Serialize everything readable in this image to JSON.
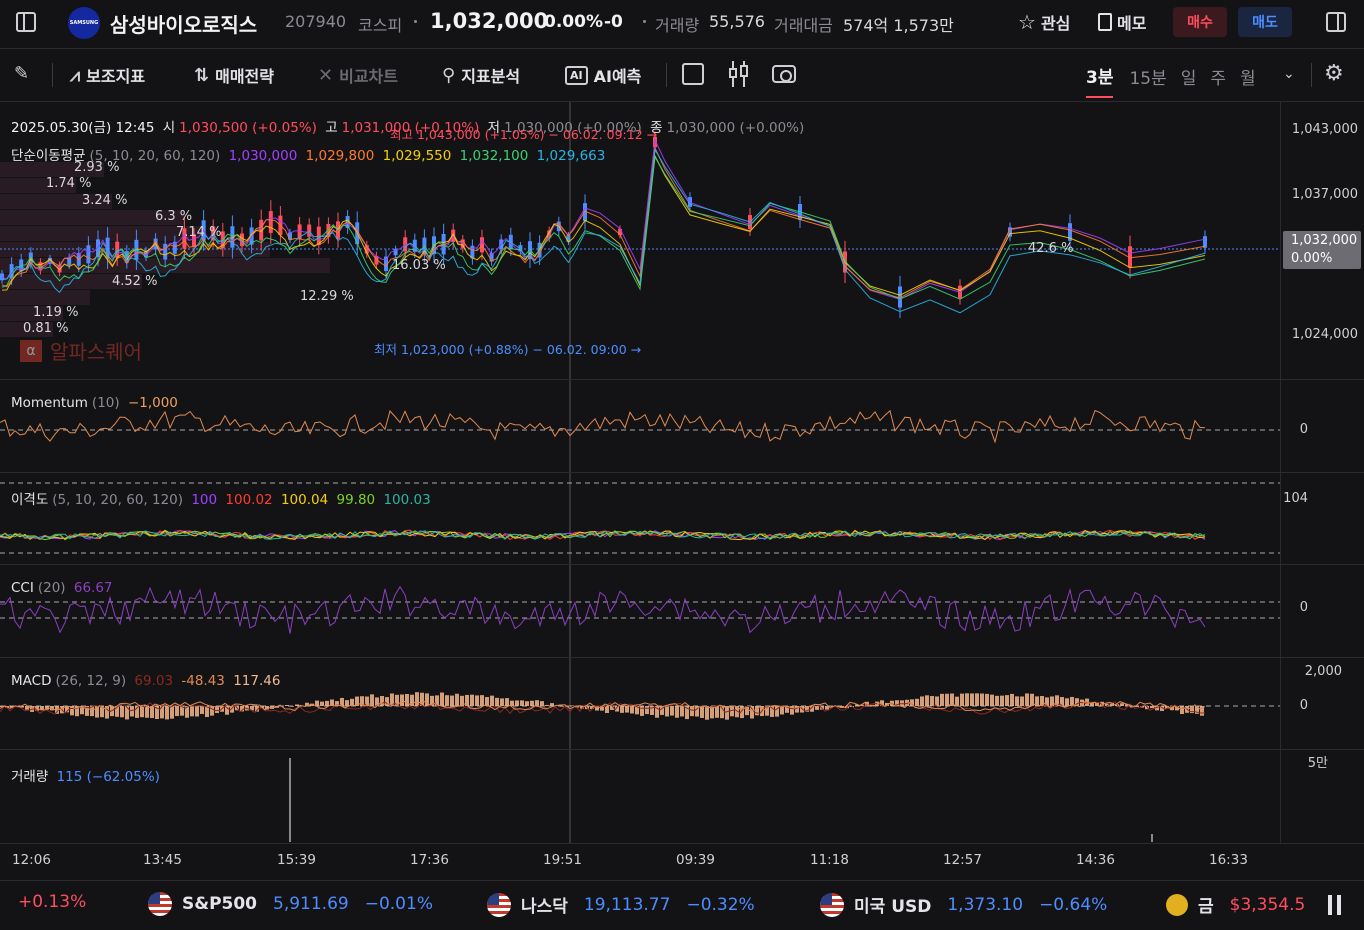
{
  "header": {
    "logo_text": "SAMSUNG",
    "name": "삼성바이오로직스",
    "code": "207940",
    "market": "코스피",
    "price": "1,032,000",
    "change_pct": "0.00%",
    "change": "-0",
    "volume_label": "거래량",
    "volume": "55,576",
    "amount_label": "거래대금",
    "amount": "574억 1,573만",
    "watch": "관심",
    "memo": "메모",
    "buy": "매수",
    "sell": "매도"
  },
  "toolbar": {
    "indicators": "보조지표",
    "strategy": "매매전략",
    "compare": "비교차트",
    "analysis": "지표분석",
    "ai": "AI예측",
    "ai_badge": "AI",
    "periods": [
      "3분",
      "15분",
      "일",
      "주",
      "월"
    ],
    "active_period": "3분"
  },
  "main_chart": {
    "date": "2025.05.30(금) 12:45",
    "open_label": "시",
    "open": "1,030,500 (+0.05%)",
    "high_label": "고",
    "high": "1,031,000 (+0.10%)",
    "low_label": "저",
    "low": "1,030,000 (+0.00%)",
    "close_label": "종",
    "close": "1,030,000 (+0.00%)",
    "ma_label": "단순이동평균",
    "ma_params": "(5, 10, 20, 60, 120)",
    "ma_values": [
      "1,030,000",
      "1,029,800",
      "1,029,550",
      "1,032,100",
      "1,029,663"
    ],
    "ma_colors": [
      "#a040ff",
      "#ff7a2e",
      "#f5d000",
      "#3bd16f",
      "#2bb3e6"
    ],
    "max_note": "최고 1,043,000 (+1.05%) − 06.02. 09:12 →",
    "min_note": "최저 1,023,000 (+0.88%) − 06.02. 09:00 →",
    "y_ticks": [
      "1,043,000",
      "1,037,000",
      "1,024,000"
    ],
    "current_price": "1,032,000",
    "current_pct": "0.00%",
    "watermark": "알파스퀘어",
    "volume_profile": [
      "2.93 %",
      "1.74 %",
      "3.24 %",
      "6.3 %",
      "7.14 %",
      "4.52 %",
      "16.03 %",
      "12.29 %",
      "42.6 %",
      "1.19 %",
      "0.81 %"
    ]
  },
  "momentum": {
    "label": "Momentum",
    "params": "(10)",
    "value": "−1,000",
    "zero": "0"
  },
  "disparity": {
    "label": "이격도",
    "params": "(5, 10, 20, 60, 120)",
    "values": [
      "100",
      "100.02",
      "100.04",
      "99.80",
      "100.03"
    ],
    "colors": [
      "#a040ff",
      "#ff3b30",
      "#f5d000",
      "#7bd12a",
      "#2bb3a6"
    ],
    "tick": "104"
  },
  "cci": {
    "label": "CCI",
    "params": "(20)",
    "value": "66.67",
    "zero": "0"
  },
  "macd": {
    "label": "MACD",
    "params": "(26, 12, 9)",
    "v1": "69.03",
    "v2": "-48.43",
    "v3": "117.46",
    "tick_top": "2,000",
    "zero": "0"
  },
  "volume": {
    "label": "거래량",
    "value": "115 (−62.05%)",
    "tick": "5만"
  },
  "x_axis": [
    "12:06",
    "13:45",
    "15:39",
    "17:36",
    "19:51",
    "09:39",
    "11:18",
    "12:57",
    "14:36",
    "16:33"
  ],
  "tickers": [
    {
      "change": "+0.13%"
    },
    {
      "name": "S&P500",
      "value": "5,911.69",
      "change": "−0.01%"
    },
    {
      "name": "나스닥",
      "value": "19,113.77",
      "change": "−0.32%"
    },
    {
      "name": "미국 USD",
      "value": "1,373.10",
      "change": "−0.64%"
    },
    {
      "name": "금",
      "value": "$3,354.5"
    }
  ]
}
